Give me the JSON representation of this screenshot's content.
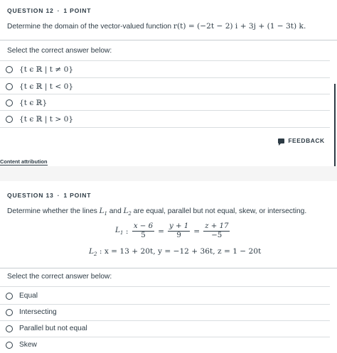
{
  "question12": {
    "label": "QUESTION 12",
    "dot": "·",
    "points": "1 POINT",
    "prompt_prefix": "Determine the domain of the vector-valued function ",
    "prompt_math": "r(t) = (−2t − 2) i + 3j + (1 − 3t) k.",
    "select_label": "Select the correct answer below:",
    "options": [
      "{t ϵ ℝ | t ≠ 0}",
      "{t ϵ ℝ | t < 0}",
      "{t ϵ ℝ}",
      "{t ϵ ℝ | t > 0}"
    ],
    "feedback_label": "FEEDBACK",
    "content_attribution": "Content attribution"
  },
  "question13": {
    "label": "QUESTION 13",
    "dot": "·",
    "points": "1 POINT",
    "prompt_part1": "Determine whether the lines ",
    "L1": "L",
    "L1_sub": "1",
    "prompt_part2": " and ",
    "L2": "L",
    "L2_sub": "2",
    "prompt_part3": " are equal, parallel but not equal, skew, or intersecting.",
    "eq1": {
      "lhs": "L",
      "lhs_sub": "1",
      "colon": " : ",
      "f1_num": "x − 6",
      "f1_den": "5",
      "f2_num": "y + 1",
      "f2_den": "9",
      "f3_num": "z + 17",
      "f3_den": "−5",
      "equals": "="
    },
    "eq2": {
      "lhs": "L",
      "lhs_sub": "2",
      "rhs": " : x = 13 + 20t, y = −12 + 36t, z = 1 − 20t"
    },
    "select_label": "Select the correct answer below:",
    "options": [
      "Equal",
      "Intersecting",
      "Parallel but not equal",
      "Skew"
    ]
  },
  "colors": {
    "text": "#2d3b45",
    "divider": "#c7cdd1",
    "band": "#f5f5f5"
  }
}
